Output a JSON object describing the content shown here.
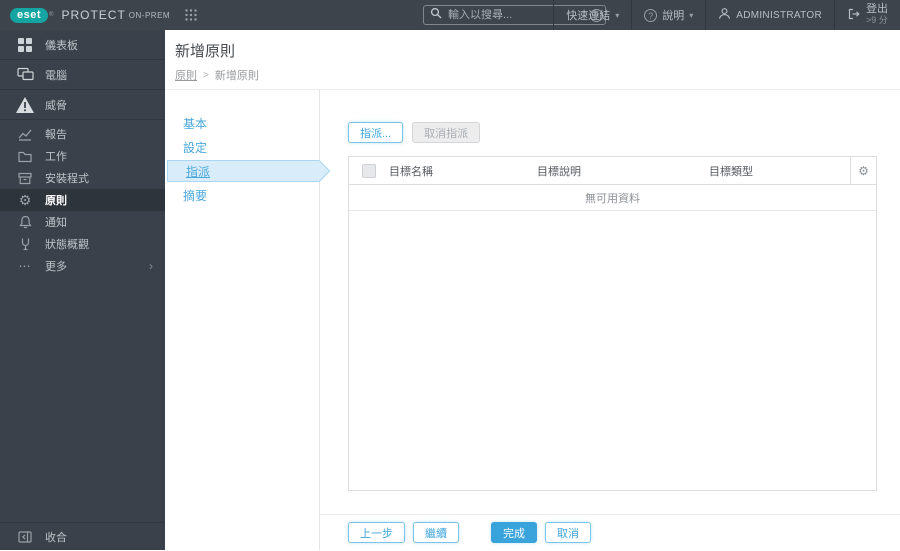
{
  "colors": {
    "accent": "#39a3db",
    "topbar_bg": "#3d444c",
    "sidebar_bg": "#3a414a",
    "logo_teal": "#14a5a3",
    "active_step_bg": "#d8ecf9"
  },
  "topbar": {
    "logo_text": "eset",
    "reg_mark": "®",
    "product": "PROTECT",
    "product_suffix": "ON-PREM",
    "search": {
      "placeholder": "輸入以搜尋...",
      "help_glyph": "?"
    },
    "quick_links_label": "快速連結",
    "help_label": "說明",
    "help_glyph": "?",
    "caret": "▾",
    "user_label": "ADMINISTRATOR",
    "logout_label": "登出",
    "logout_timer": ">9 分"
  },
  "sidebar": {
    "items": [
      {
        "label": "儀表板"
      },
      {
        "label": "電腦"
      },
      {
        "label": "威脅"
      },
      {
        "label": "報告"
      },
      {
        "label": "工作"
      },
      {
        "label": "安裝程式"
      },
      {
        "label": "原則"
      },
      {
        "label": "通知"
      },
      {
        "label": "狀態概觀"
      },
      {
        "label": "更多"
      }
    ],
    "more_chevron": "›",
    "more_dots": "⋯",
    "policies_gear": "⚙",
    "collapse_label": "收合"
  },
  "header": {
    "title": "新增原則",
    "breadcrumb": {
      "parent": "原則",
      "separator": ">",
      "current": "新增原則"
    }
  },
  "wizard": {
    "steps": [
      {
        "label": "基本"
      },
      {
        "label": "設定"
      },
      {
        "label": "指派"
      },
      {
        "label": "摘要"
      }
    ]
  },
  "content": {
    "assign_button": "指派...",
    "unassign_button": "取消指派",
    "table": {
      "columns": [
        "目標名稱",
        "目標說明",
        "目標類型"
      ],
      "gear_glyph": "⚙",
      "empty": "無可用資料"
    },
    "footer": {
      "back": "上一步",
      "continue": "繼續",
      "finish": "完成",
      "cancel": "取消"
    }
  }
}
